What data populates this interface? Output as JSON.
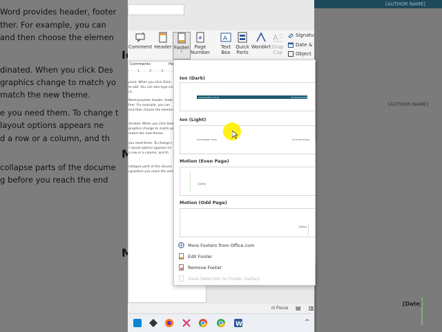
{
  "background_left": {
    "lines": [
      "Word provides header, footer",
      "ther. For example, you can",
      "and then choose the elemen",
      "dinated. When you click Des",
      "graphics change to match yo",
      "match the new theme.",
      "e you need them. To change t",
      "layout options appears ne",
      "d a row or a column, and th",
      "collapse parts of the docume",
      "g before you reach the end"
    ],
    "heading_letters": [
      "Io",
      "M",
      "M"
    ]
  },
  "background_right": {
    "author_top": "[AUTHOR NAME]",
    "author_mid": "[AUTHOR NAME]",
    "date": "[Date]"
  },
  "doc_thumb": {
    "comments": "Comments",
    "he": "He",
    "lines": [
      "point. When you click Onlin",
      "to add. You can also type a k",
      "nt.",
      "Word provides header, foote",
      "ther. For example, you can",
      "and then choose the elemen",
      "dinated. When you click Desi",
      "graphics change to match yo",
      "match the new theme.",
      "you need them. To change t",
      "r layout options appears ne",
      "a row or a column, and th",
      "collapse parts of the docum",
      "ng before you reach the end"
    ]
  },
  "ribbon": {
    "comment": "Comment",
    "header": "Header",
    "footer": "Footer",
    "page_number_1": "Page",
    "page_number_2": "Number",
    "text_box_1": "Text",
    "text_box_2": "Box",
    "quick_parts_1": "Quick",
    "quick_parts_2": "Parts",
    "wordart": "WordArt",
    "drop_cap_1": "Drop",
    "drop_cap_2": "Cap",
    "signature": "Signature",
    "date_time": "Date & T",
    "object": "Object"
  },
  "gallery": {
    "sections": [
      {
        "title": "Ion (Dark)",
        "left": "[DOCUMENT TITLE]",
        "right": "[AUTHOR NAME]"
      },
      {
        "title": "Ion (Light)",
        "left": "[DOCUMENT TITLE]",
        "right": "[AUTHOR NAME]"
      },
      {
        "title": "Motion (Even Page)",
        "label": "[Date]"
      },
      {
        "title": "Motion (Odd Page)",
        "label": "[Date]"
      }
    ],
    "menu": {
      "more": "More Footers from Office.com",
      "edit": "Edit Footer",
      "remove": "Remove Footer",
      "save": "Save Selection to Footer Gallery"
    }
  },
  "status": {
    "focus": "Focus"
  },
  "colors": {
    "ion_dark_bar": "#1e5a72",
    "accent": "#2b579a"
  }
}
